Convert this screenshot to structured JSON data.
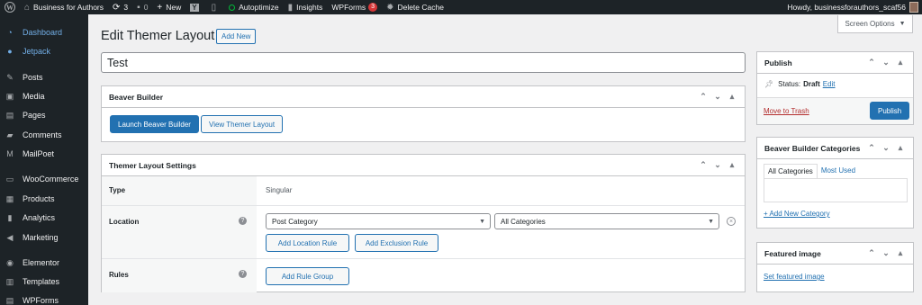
{
  "adminbar": {
    "site_name": "Business for Authors",
    "updates_count": "3",
    "comments_count": "0",
    "new_label": "New",
    "autoptimize": "Autoptimize",
    "insights": "Insights",
    "wpforms": "WPForms",
    "wpforms_badge": "3",
    "delete_cache": "Delete Cache",
    "howdy": "Howdy, businessforauthors_scaf56"
  },
  "sidebar": {
    "items": [
      {
        "label": "Dashboard",
        "icon": "dashboard-icon"
      },
      {
        "label": "Jetpack",
        "icon": "jetpack-icon"
      },
      {
        "label": "Posts",
        "icon": "pin-icon"
      },
      {
        "label": "Media",
        "icon": "media-icon"
      },
      {
        "label": "Pages",
        "icon": "pages-icon"
      },
      {
        "label": "Comments",
        "icon": "comment-icon"
      },
      {
        "label": "MailPoet",
        "icon": "mailpoet-icon"
      },
      {
        "label": "WooCommerce",
        "icon": "woocommerce-icon"
      },
      {
        "label": "Products",
        "icon": "products-icon"
      },
      {
        "label": "Analytics",
        "icon": "analytics-icon"
      },
      {
        "label": "Marketing",
        "icon": "marketing-icon"
      },
      {
        "label": "Elementor",
        "icon": "elementor-icon"
      },
      {
        "label": "Templates",
        "icon": "templates-icon"
      },
      {
        "label": "WPForms",
        "icon": "wpforms-icon"
      }
    ]
  },
  "header": {
    "title": "Edit Themer Layout",
    "add_new": "Add New",
    "screen_options": "Screen Options"
  },
  "post_title": "Test",
  "beaver_builder": {
    "title": "Beaver Builder",
    "launch": "Launch Beaver Builder",
    "view": "View Themer Layout"
  },
  "themer_settings": {
    "title": "Themer Layout Settings",
    "type_label": "Type",
    "type_value": "Singular",
    "location_label": "Location",
    "location_select": "Post Category",
    "category_select": "All Categories",
    "add_location_rule": "Add Location Rule",
    "add_exclusion_rule": "Add Exclusion Rule",
    "rules_label": "Rules",
    "add_rule_group": "Add Rule Group"
  },
  "publish": {
    "title": "Publish",
    "status_label": "Status:",
    "status_value": "Draft",
    "edit_link": "Edit",
    "move_to_trash": "Move to Trash",
    "publish_button": "Publish"
  },
  "categories": {
    "title": "Beaver Builder Categories",
    "tab_all": "All Categories",
    "tab_most_used": "Most Used",
    "add_new": "+ Add New Category"
  },
  "featured_image": {
    "title": "Featured image",
    "set_link": "Set featured image"
  },
  "colors": {
    "admin_dark": "#1d2327",
    "accent": "#2271b1",
    "sidebar_active": "#72aee6",
    "trash_red": "#b32d2e"
  }
}
